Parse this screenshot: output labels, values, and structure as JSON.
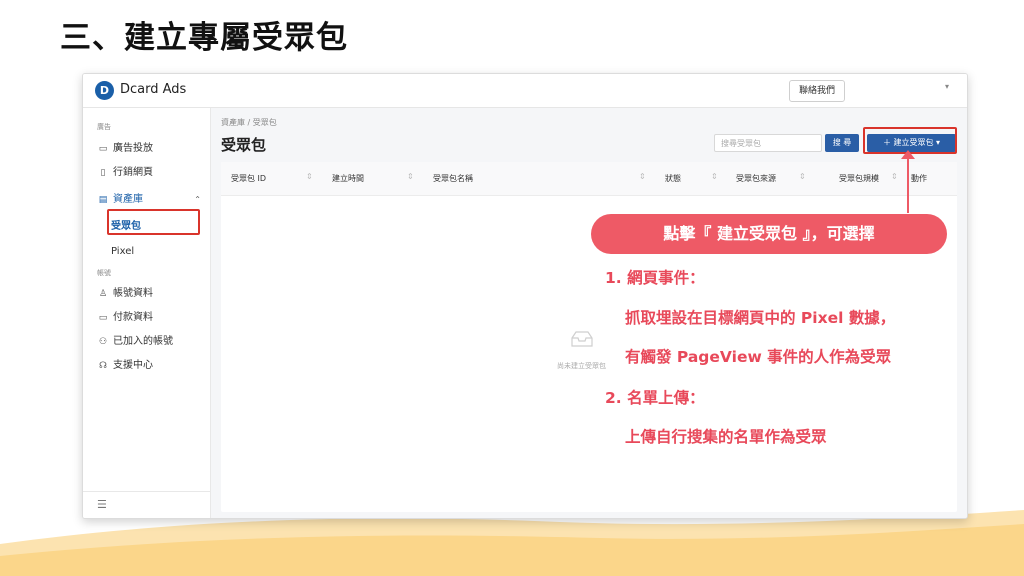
{
  "slide": {
    "title": "三、建立專屬受眾包"
  },
  "app": {
    "logo_letter": "D",
    "brand": "Dcard Ads",
    "contact_label": "聯絡我們"
  },
  "sidebar": {
    "section_ads": "廣告",
    "items": [
      {
        "icon": "ad-icon",
        "glyph": "▭",
        "label": "廣告投放"
      },
      {
        "icon": "phone-icon",
        "glyph": "▯",
        "label": "行銷網頁"
      },
      {
        "icon": "list-icon",
        "glyph": "▤",
        "label": "資產庫",
        "caret": "⌃"
      }
    ],
    "sub_items": [
      "受眾包",
      "Pixel"
    ],
    "section_account": "帳號",
    "account_items": [
      {
        "icon": "user-icon",
        "glyph": "♙",
        "label": "帳號資料"
      },
      {
        "icon": "card-icon",
        "glyph": "▭",
        "label": "付款資料"
      },
      {
        "icon": "users-icon",
        "glyph": "⚇",
        "label": "已加入的帳號"
      },
      {
        "icon": "headset-icon",
        "glyph": "☊",
        "label": "支援中心"
      }
    ],
    "collapse_glyph": "☰"
  },
  "main": {
    "breadcrumb": "資產庫 / 受眾包",
    "title": "受眾包",
    "search_placeholder": "搜尋受眾包",
    "search_button": "搜 尋",
    "create_button": "＋  建立受眾包  ▾",
    "columns": [
      "受眾包 ID",
      "建立時間",
      "受眾包名稱",
      "狀態",
      "受眾包來源",
      "受眾包規模",
      "動作"
    ],
    "empty_text": "尚未建立受眾包"
  },
  "callout": {
    "pill": "點擊『 建立受眾包 』，可選擇",
    "lines": [
      "1. 網頁事件：",
      "抓取埋設在目標網頁中的 Pixel 數據，",
      "有觸發 PageView 事件的人作為受眾",
      "2. 名單上傳：",
      "上傳自行搜集的名單作為受眾"
    ]
  },
  "colors": {
    "brand_blue": "#2a5ea6",
    "highlight_red": "#d9342b",
    "callout_pink": "#ee5a66",
    "wave_orange": "#fbd68a"
  }
}
